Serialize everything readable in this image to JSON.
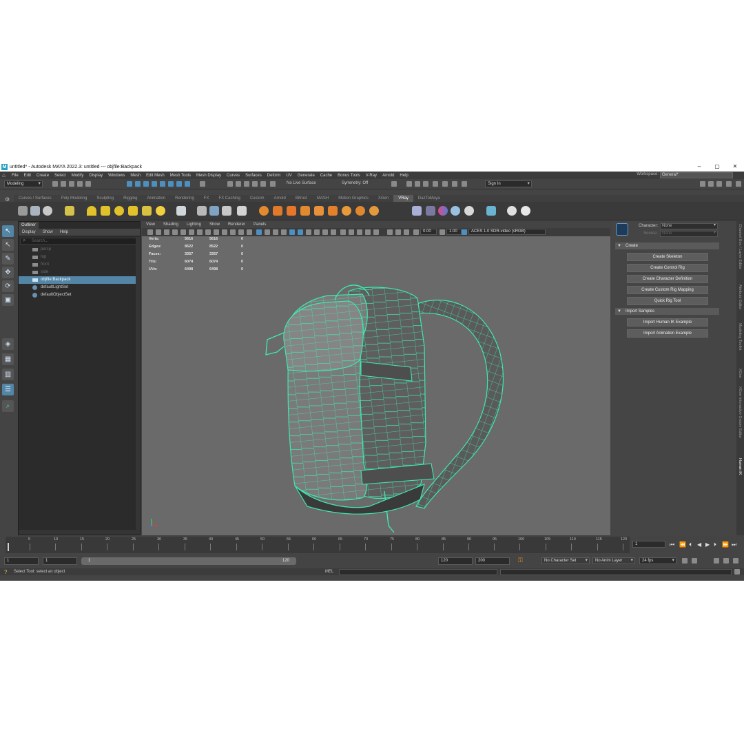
{
  "window": {
    "title": "untitled* - Autodesk MAYA 2022.3: untitled   ---   objfile:Backpack",
    "logo": "M",
    "controls": [
      "–",
      "▢",
      "✕"
    ]
  },
  "menubar": {
    "items": [
      "File",
      "Edit",
      "Create",
      "Select",
      "Modify",
      "Display",
      "Windows",
      "Mesh",
      "Edit Mesh",
      "Mesh Tools",
      "Mesh Display",
      "Curves",
      "Surfaces",
      "Deform",
      "UV",
      "Generate",
      "Cache",
      "Bonus Tools",
      "V-Ray",
      "Arnold",
      "Help"
    ],
    "workspace_label": "Workspace:",
    "workspace_value": "General*"
  },
  "statusline": {
    "menu_set": "Modeling",
    "live_surface": "No Live Surface",
    "symmetry": "Symmetry: Off",
    "sign_in": "Sign In"
  },
  "shelf": {
    "tabs": [
      "Curves / Surfaces",
      "Poly Modeling",
      "Sculpting",
      "Rigging",
      "Animation",
      "Rendering",
      "FX",
      "FX Caching",
      "Custom",
      "Arnold",
      "Bifrost",
      "MASH",
      "Motion Graphics",
      "XGen",
      "VRay",
      "DazToMaya"
    ],
    "active_tab": "VRay"
  },
  "outliner": {
    "title": "Outliner",
    "menu": [
      "Display",
      "Show",
      "Help"
    ],
    "search_placeholder": "Search...",
    "items": [
      {
        "label": "persp",
        "dim": true
      },
      {
        "label": "top",
        "dim": true
      },
      {
        "label": "front",
        "dim": true
      },
      {
        "label": "side",
        "dim": true
      },
      {
        "label": "objfile:Backpack",
        "selected": true
      },
      {
        "label": "defaultLightSet"
      },
      {
        "label": "defaultObjectSet"
      }
    ]
  },
  "viewport": {
    "menu": [
      "View",
      "Shading",
      "Lighting",
      "Show",
      "Renderer",
      "Panels"
    ],
    "exposure": "0.00",
    "gamma": "1.00",
    "color_space": "ACES 1.0 SDR-video (sRGB)",
    "hud": [
      {
        "label": "Verts:",
        "a": "5616",
        "b": "5616",
        "c": "0"
      },
      {
        "label": "Edges:",
        "a": "8522",
        "b": "8522",
        "c": "0"
      },
      {
        "label": "Faces:",
        "a": "3357",
        "b": "3357",
        "c": "0"
      },
      {
        "label": "Tris:",
        "a": "6074",
        "b": "6074",
        "c": "0"
      },
      {
        "label": "UVs:",
        "a": "6498",
        "b": "6498",
        "c": "0"
      }
    ],
    "wire_color": "#3fe8b0"
  },
  "human_ik": {
    "character_label": "Character:",
    "character_value": "None",
    "source_label": "Source:",
    "source_value": "None",
    "create_section": "Create",
    "create_buttons": [
      "Create Skeleton",
      "Create Control Rig",
      "Create Character Definition",
      "Create Custom Rig Mapping",
      "Quick Rig Tool"
    ],
    "import_section": "Import Samples",
    "import_buttons": [
      "Import Human IK Example",
      "Import Animation Example"
    ]
  },
  "side_tabs": [
    "Channel Box / Layer Editor",
    "Attribute Editor",
    "Modeling Toolkit",
    "XGen",
    "XGen Interactive Groom Editor",
    "Human IK"
  ],
  "timeline": {
    "ticks": [
      "5",
      "10",
      "15",
      "20",
      "25",
      "30",
      "35",
      "40",
      "45",
      "50",
      "55",
      "60",
      "65",
      "70",
      "75",
      "80",
      "85",
      "90",
      "95",
      "100",
      "105",
      "110",
      "115",
      "120"
    ],
    "current_frame": "1"
  },
  "range": {
    "start": "1",
    "playback_start": "1",
    "range_start": "1",
    "range_end": "120",
    "playback_end": "120",
    "end": "200",
    "character_set": "No Character Set",
    "anim_layer": "No Anim Layer",
    "fps": "24 fps"
  },
  "commandline": {
    "help_text": "Select Tool: select an object",
    "mel_label": "MEL"
  }
}
